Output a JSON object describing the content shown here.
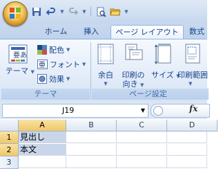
{
  "quick_access": {
    "icons": [
      "save-icon",
      "undo-icon",
      "redo-icon",
      "print-preview-icon",
      "open-folder-icon"
    ]
  },
  "tabs": [
    {
      "label": "ホーム",
      "active": false
    },
    {
      "label": "挿入",
      "active": false
    },
    {
      "label": "ページ レイアウト",
      "active": true
    },
    {
      "label": "数式",
      "active": false
    }
  ],
  "ribbon": {
    "theme_group": {
      "label": "テーマ",
      "theme_button": "テーマ",
      "colors": "配色",
      "fonts": "フォント",
      "effects": "効果"
    },
    "page_setup_group": {
      "label": "ページ設定",
      "margins": "余白",
      "orientation_line1": "印刷の",
      "orientation_line2": "向き",
      "size": "サイズ",
      "print_area": "印刷範囲"
    }
  },
  "formula_bar": {
    "name_box": "J19",
    "fx_label": "fx",
    "formula": ""
  },
  "sheet": {
    "columns": [
      "A",
      "B",
      "C",
      "D"
    ],
    "rows": [
      "1",
      "2",
      "3"
    ],
    "cells": {
      "A1": "見出し",
      "A2": "本文"
    }
  },
  "colors": {
    "ribbon_text": "#15428b",
    "selection": "#c9d6ea",
    "header_selected": "#f2c766"
  }
}
